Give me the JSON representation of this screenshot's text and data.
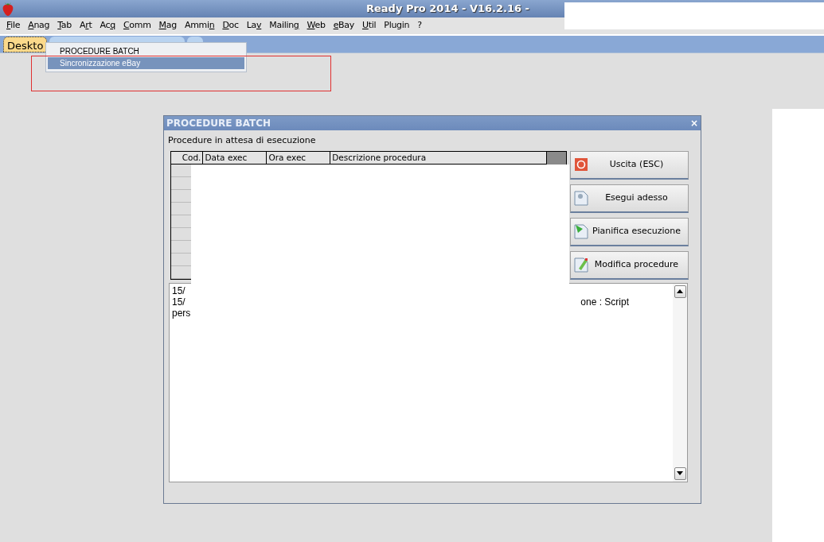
{
  "window": {
    "title": "Ready Pro 2014 - V16.2.16 -"
  },
  "menu": [
    {
      "key": "F",
      "after": "ile"
    },
    {
      "key": "A",
      "after": "nag"
    },
    {
      "key": "T",
      "after": "ab"
    },
    {
      "before": "A",
      "key": "r",
      "after": "t"
    },
    {
      "before": "Ac",
      "key": "q"
    },
    {
      "key": "C",
      "after": "omm"
    },
    {
      "key": "M",
      "after": "ag"
    },
    {
      "before": "Ammi",
      "key": "n"
    },
    {
      "key": "D",
      "after": "oc"
    },
    {
      "before": "La",
      "key": "v"
    },
    {
      "before": "Mailin",
      "key": "g"
    },
    {
      "key": "W",
      "after": "eb"
    },
    {
      "key": "e",
      "after": "Bay"
    },
    {
      "key": "U",
      "after": "til"
    },
    {
      "before": "Plugin"
    },
    {
      "before": "?"
    }
  ],
  "tabs": [
    {
      "label": "Deskto",
      "selected": true
    },
    {
      "selected": false
    },
    {
      "selected": false
    }
  ],
  "dropdown": [
    {
      "label": "PROCEDURE BATCH",
      "selected": false
    },
    {
      "label": "Sincronizzazione eBay",
      "selected": true
    }
  ],
  "dialog": {
    "title": "PROCEDURE BATCH",
    "close": "×",
    "caption": "Procedure in attesa di esecuzione",
    "table": {
      "columns": [
        "Cod.",
        "Data exec",
        "Ora exec",
        "Descrizione procedura"
      ]
    },
    "buttons": [
      {
        "label": "Uscita (ESC)",
        "kind": "exit"
      },
      {
        "label": "Esegui adesso",
        "kind": "run"
      },
      {
        "label": "Pianifica esecuzione",
        "kind": "schedule"
      },
      {
        "label": "Modifica procedure",
        "kind": "edit"
      }
    ],
    "log": [
      {
        "start": "15/"
      },
      {
        "start": "15/",
        "end": "one : Script"
      },
      {
        "start": "pers"
      }
    ]
  }
}
